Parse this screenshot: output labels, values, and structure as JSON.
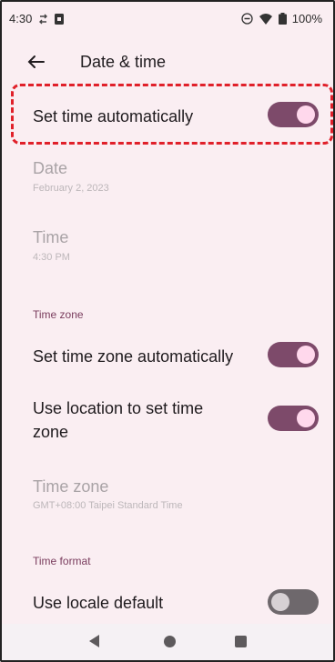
{
  "status_bar": {
    "time": "4:30",
    "battery": "100%"
  },
  "app_bar": {
    "title": "Date & time"
  },
  "settings": {
    "set_time_auto": {
      "title": "Set time automatically",
      "enabled": true
    },
    "date": {
      "title": "Date",
      "value": "February 2, 2023"
    },
    "time": {
      "title": "Time",
      "value": "4:30 PM"
    },
    "time_zone_section": "Time zone",
    "set_tz_auto": {
      "title": "Set time zone automatically",
      "enabled": true
    },
    "use_location": {
      "title_line1": "Use location to set time",
      "title_line2": "zone",
      "enabled": true
    },
    "time_zone": {
      "title": "Time zone",
      "value": "GMT+08:00 Taipei Standard Time"
    },
    "time_format_section": "Time format",
    "use_locale_default": {
      "title": "Use locale default",
      "enabled": false
    }
  },
  "colors": {
    "background": "#faeef2",
    "toggle_on": "#7d4a6a",
    "toggle_off": "#6e686c",
    "section_accent": "#7a3d5e",
    "highlight": "#e0202a"
  },
  "icons": {
    "back": "arrow-left",
    "nav_back": "triangle-left",
    "nav_home": "circle",
    "nav_recents": "square"
  }
}
